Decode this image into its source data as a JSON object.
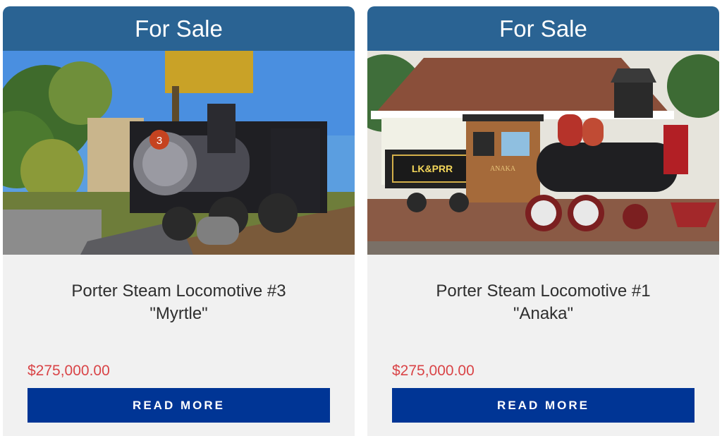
{
  "listings": [
    {
      "badge": "For Sale",
      "title_line1": "Porter Steam Locomotive #3",
      "title_line2": "\"Myrtle\"",
      "price": "$275,000.00",
      "button_label": "READ MORE",
      "photo_icon": "steam-locomotive-3-photo",
      "number_plate": "3"
    },
    {
      "badge": "For Sale",
      "title_line1": "Porter Steam Locomotive #1",
      "title_line2": "\"Anaka\"",
      "price": "$275,000.00",
      "button_label": "READ MORE",
      "photo_icon": "steam-locomotive-1-photo",
      "tender_sign": "LK&PRR",
      "cab_sign": "ANAKA"
    }
  ],
  "colors": {
    "banner": "#2a6393",
    "card_background": "#f1f1f1",
    "price": "#d94447",
    "button": "#003595",
    "title_text": "#2e2e2e"
  }
}
